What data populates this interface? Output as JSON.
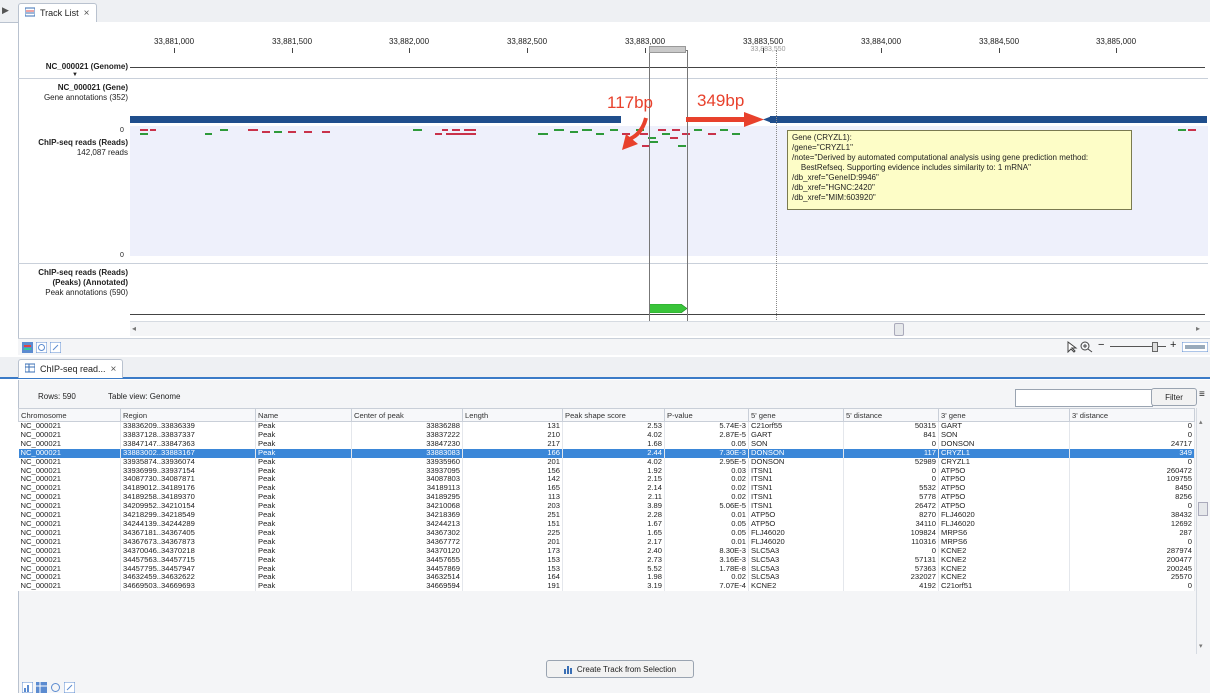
{
  "top_tab": {
    "label": "Track List",
    "close": "×"
  },
  "ruler": {
    "ticks": [
      "33,881,000",
      "33,881,500",
      "33,882,000",
      "33,882,500",
      "33,883,000",
      "33,883,500",
      "33,884,000",
      "33,884,500",
      "33,885,000"
    ],
    "cursor_label": "33,883,550"
  },
  "tracks": {
    "genome": {
      "name": "NC_000021 (Genome)"
    },
    "gene": {
      "name": "NC_000021 (Gene)",
      "sub": "Gene annotations (352)"
    },
    "chip": {
      "name": "ChIP-seq reads (Reads)",
      "sub": "142,087 reads",
      "axis_top": "0",
      "axis_bottom": "0"
    },
    "peaks": {
      "name1": "ChIP-seq reads (Reads)",
      "name2": "(Peaks) (Annotated)",
      "sub": "Peak annotations (590)"
    }
  },
  "annotations": {
    "left_bp": "117bp",
    "right_bp": "349bp"
  },
  "tooltip": {
    "lines": [
      "Gene (CRYZL1):",
      "/gene=\"CRYZL1\"",
      "/note=\"Derived by automated computational analysis using gene prediction method:",
      "    BestRefseq. Supporting evidence includes similarity to: 1 mRNA\"",
      "/db_xref=\"GeneID:9946\"",
      "/db_xref=\"HGNC:2420\"",
      "/db_xref=\"MIM:603920\""
    ]
  },
  "table_tab": {
    "label": "ChIP-seq read...",
    "close": "×"
  },
  "table_info": {
    "rows": "Rows: 590",
    "view": "Table view: Genome"
  },
  "filter": {
    "button": "Filter",
    "value": ""
  },
  "columns": [
    "Chromosome",
    "Region",
    "Name",
    "Center of peak",
    "Length",
    "Peak shape score",
    "P-value",
    "5' gene",
    "5' distance",
    "3' gene",
    "3' distance"
  ],
  "rows": [
    [
      "NC_000021",
      "33836209..33836339",
      "Peak",
      "33836288",
      "131",
      "2.53",
      "5.74E-3",
      "C21orf55",
      "50315",
      "GART",
      "0"
    ],
    [
      "NC_000021",
      "33837128..33837337",
      "Peak",
      "33837222",
      "210",
      "4.02",
      "2.87E-5",
      "GART",
      "841",
      "SON",
      "0"
    ],
    [
      "NC_000021",
      "33847147..33847363",
      "Peak",
      "33847230",
      "217",
      "1.68",
      "0.05",
      "SON",
      "0",
      "DONSON",
      "24717"
    ],
    [
      "NC_000021",
      "33883002..33883167",
      "Peak",
      "33883083",
      "166",
      "2.44",
      "7.30E-3",
      "DONSON",
      "117",
      "CRYZL1",
      "349"
    ],
    [
      "NC_000021",
      "33935874..33936074",
      "Peak",
      "33935960",
      "201",
      "4.02",
      "2.95E-5",
      "DONSON",
      "52989",
      "CRYZL1",
      "0"
    ],
    [
      "NC_000021",
      "33936999..33937154",
      "Peak",
      "33937095",
      "156",
      "1.92",
      "0.03",
      "ITSN1",
      "0",
      "ATP5O",
      "260472"
    ],
    [
      "NC_000021",
      "34087730..34087871",
      "Peak",
      "34087803",
      "142",
      "2.15",
      "0.02",
      "ITSN1",
      "0",
      "ATP5O",
      "109755"
    ],
    [
      "NC_000021",
      "34189012..34189176",
      "Peak",
      "34189113",
      "165",
      "2.14",
      "0.02",
      "ITSN1",
      "5532",
      "ATP5O",
      "8450"
    ],
    [
      "NC_000021",
      "34189258..34189370",
      "Peak",
      "34189295",
      "113",
      "2.11",
      "0.02",
      "ITSN1",
      "5778",
      "ATP5O",
      "8256"
    ],
    [
      "NC_000021",
      "34209952..34210154",
      "Peak",
      "34210068",
      "203",
      "3.89",
      "5.06E-5",
      "ITSN1",
      "26472",
      "ATP5O",
      "0"
    ],
    [
      "NC_000021",
      "34218299..34218549",
      "Peak",
      "34218369",
      "251",
      "2.28",
      "0.01",
      "ATP5O",
      "8270",
      "FLJ46020",
      "38432"
    ],
    [
      "NC_000021",
      "34244139..34244289",
      "Peak",
      "34244213",
      "151",
      "1.67",
      "0.05",
      "ATP5O",
      "34110",
      "FLJ46020",
      "12692"
    ],
    [
      "NC_000021",
      "34367181..34367405",
      "Peak",
      "34367302",
      "225",
      "1.65",
      "0.05",
      "FLJ46020",
      "109824",
      "MRPS6",
      "287"
    ],
    [
      "NC_000021",
      "34367673..34367873",
      "Peak",
      "34367772",
      "201",
      "2.17",
      "0.01",
      "FLJ46020",
      "110316",
      "MRPS6",
      "0"
    ],
    [
      "NC_000021",
      "34370046..34370218",
      "Peak",
      "34370120",
      "173",
      "2.40",
      "8.30E-3",
      "SLC5A3",
      "0",
      "KCNE2",
      "287974"
    ],
    [
      "NC_000021",
      "34457563..34457715",
      "Peak",
      "34457655",
      "153",
      "2.73",
      "3.16E-3",
      "SLC5A3",
      "57131",
      "KCNE2",
      "200477"
    ],
    [
      "NC_000021",
      "34457795..34457947",
      "Peak",
      "34457869",
      "153",
      "5.52",
      "1.78E-8",
      "SLC5A3",
      "57363",
      "KCNE2",
      "200245"
    ],
    [
      "NC_000021",
      "34632459..34632622",
      "Peak",
      "34632514",
      "164",
      "1.98",
      "0.02",
      "SLC5A3",
      "232027",
      "KCNE2",
      "25570"
    ],
    [
      "NC_000021",
      "34669503..34669693",
      "Peak",
      "34669594",
      "191",
      "3.19",
      "7.07E-4",
      "KCNE2",
      "4192",
      "C21orf51",
      "0"
    ]
  ],
  "selected_row_index": 3,
  "create_track_button": "Create Track from Selection",
  "colors": {
    "selection": "#3b87d8",
    "gene_bar": "#1f4e8c",
    "annotation": "#e8412c",
    "peak": "#39c43a",
    "tooltip_bg": "#fdfdc7"
  }
}
